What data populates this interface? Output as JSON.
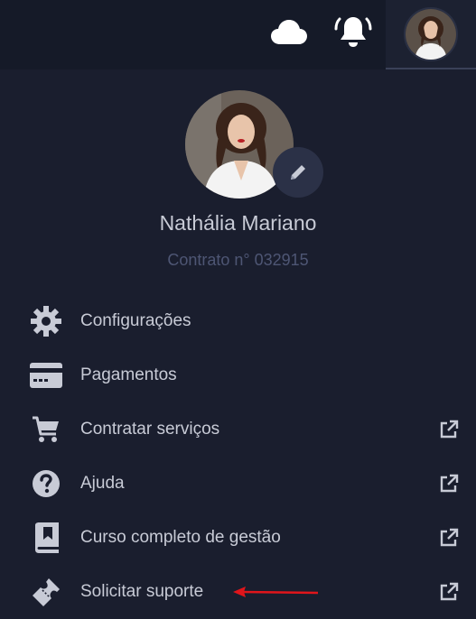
{
  "header": {
    "icons": [
      "cloud-icon",
      "bell-icon",
      "user-avatar"
    ]
  },
  "profile": {
    "name": "Nathália Mariano",
    "contract": "Contrato n° 032915"
  },
  "menu": {
    "items": [
      {
        "label": "Configurações",
        "icon": "gear-icon",
        "external": false
      },
      {
        "label": "Pagamentos",
        "icon": "credit-card-icon",
        "external": false
      },
      {
        "label": "Contratar serviços",
        "icon": "cart-icon",
        "external": true
      },
      {
        "label": "Ajuda",
        "icon": "question-circle-icon",
        "external": true
      },
      {
        "label": "Curso completo de gestão",
        "icon": "book-icon",
        "external": true
      },
      {
        "label": "Solicitar suporte",
        "icon": "ticket-icon",
        "external": true
      }
    ]
  },
  "colors": {
    "background": "#1a1e2e",
    "topbar": "#151a28",
    "text": "#c8cbd6",
    "muted": "#4e5674",
    "icon": "#c8cbd6",
    "annotation_arrow": "#e0151b"
  }
}
